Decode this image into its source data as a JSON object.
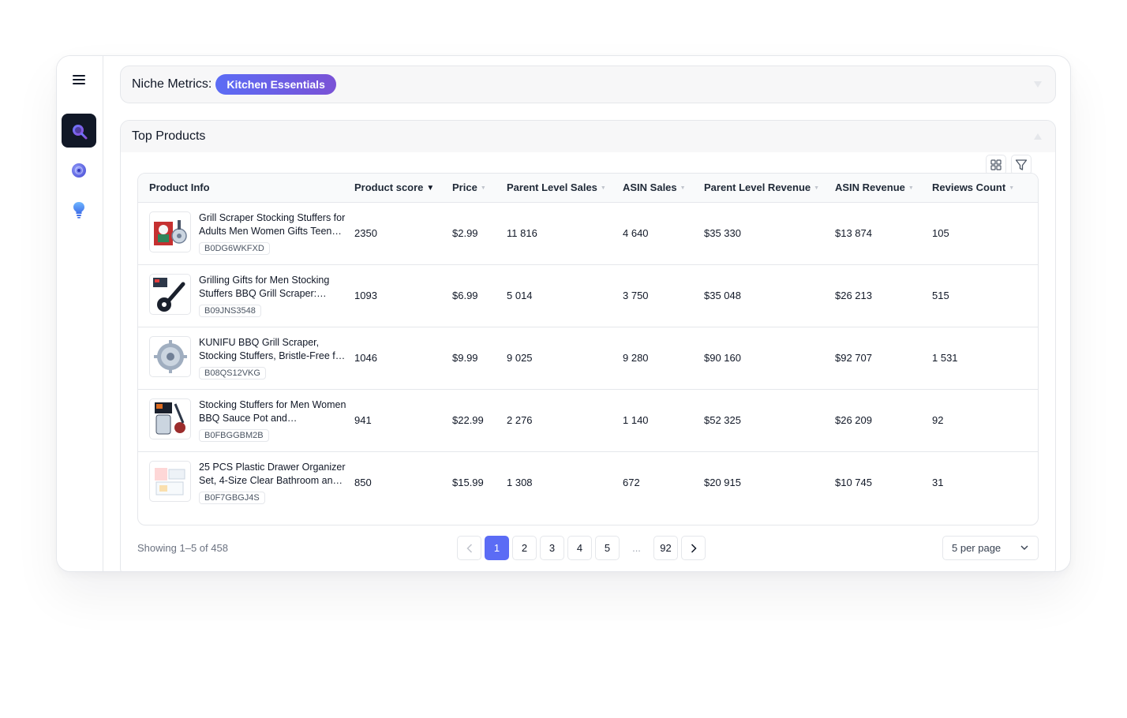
{
  "niche": {
    "label": "Niche Metrics:",
    "value": "Kitchen Essentials"
  },
  "products": {
    "title": "Top Products",
    "columns": [
      {
        "label": "Product Info",
        "sort": "none"
      },
      {
        "label": "Product score",
        "sort": "active"
      },
      {
        "label": "Price",
        "sort": "inactive"
      },
      {
        "label": "Parent Level Sales",
        "sort": "inactive"
      },
      {
        "label": "ASIN Sales",
        "sort": "inactive"
      },
      {
        "label": "Parent Level Revenue",
        "sort": "inactive"
      },
      {
        "label": "ASIN Revenue",
        "sort": "inactive"
      },
      {
        "label": "Reviews Count",
        "sort": "inactive"
      }
    ],
    "rows": [
      {
        "title": "Grill Scraper Stocking Stuffers for Adults Men Women Gifts Teen…",
        "asin": "B0DG6WKFXD",
        "score": "2350",
        "price": "$2.99",
        "parent_sales": "11 816",
        "asin_sales": "4 640",
        "parent_revenue": "$35 330",
        "asin_revenue": "$13 874",
        "reviews": "105"
      },
      {
        "title": "Grilling Gifts for Men Stocking Stuffers BBQ Grill Scraper:…",
        "asin": "B09JNS3548",
        "score": "1093",
        "price": "$6.99",
        "parent_sales": "5 014",
        "asin_sales": "3 750",
        "parent_revenue": "$35 048",
        "asin_revenue": "$26 213",
        "reviews": "515"
      },
      {
        "title": "KUNIFU BBQ Grill Scraper, Stocking Stuffers, Bristle-Free f…",
        "asin": "B08QS12VKG",
        "score": "1046",
        "price": "$9.99",
        "parent_sales": "9 025",
        "asin_sales": "9 280",
        "parent_revenue": "$90 160",
        "asin_revenue": "$92 707",
        "reviews": "1 531"
      },
      {
        "title": "Stocking Stuffers for Men Women BBQ Sauce Pot and…",
        "asin": "B0FBGGBM2B",
        "score": "941",
        "price": "$22.99",
        "parent_sales": "2 276",
        "asin_sales": "1 140",
        "parent_revenue": "$52 325",
        "asin_revenue": "$26 209",
        "reviews": "92"
      },
      {
        "title": "25 PCS Plastic Drawer Organizer Set, 4-Size Clear Bathroom an…",
        "asin": "B0F7GBGJ4S",
        "score": "850",
        "price": "$15.99",
        "parent_sales": "1 308",
        "asin_sales": "672",
        "parent_revenue": "$20 915",
        "asin_revenue": "$10 745",
        "reviews": "31"
      }
    ]
  },
  "pagination": {
    "showing": "Showing 1–5 of 458",
    "pages": [
      "1",
      "2",
      "3",
      "4",
      "5"
    ],
    "ellipsis": "...",
    "last": "92",
    "current": "1",
    "per_page": "5 per page"
  },
  "icons": {
    "menu": "hamburger-icon",
    "search": "search-icon",
    "target": "target-icon",
    "idea": "lightbulb-icon",
    "grid": "grid-view-icon",
    "filter": "filter-icon"
  },
  "colors": {
    "accent": "#5b6cf5",
    "pill_start": "#5b6cf5",
    "pill_end": "#7a52d6",
    "nav_active": "#111827"
  }
}
